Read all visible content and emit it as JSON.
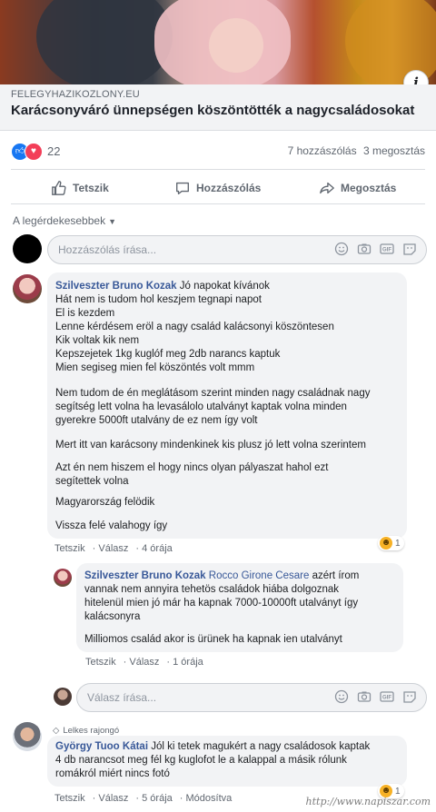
{
  "post": {
    "link_domain": "FELEGYHAZIKOZLONY.EU",
    "link_title": "Karácsonyváró ünnepségen köszöntötték a nagycsaládosokat",
    "reaction_count": "22",
    "comments_count": "7 hozzászólás",
    "shares_count": "3 megosztás"
  },
  "actions": {
    "like": "Tetszik",
    "comment": "Hozzászólás",
    "share": "Megosztás"
  },
  "sort_label": "A legérdekesebbek",
  "composer": {
    "placeholder": "Hozzászólás írása...",
    "reply_placeholder": "Válasz írása..."
  },
  "comments": [
    {
      "author": "Szilveszter Bruno Kozak",
      "first_line": "Jó napokat kívánok",
      "lines": [
        "Hát nem is tudom hol keszjem tegnapi napot",
        "El is kezdem",
        "Lenne kérdésem eröl a nagy család kalácsonyi köszöntesen",
        "Kik voltak kik nem",
        "Kepszejetek 1kg kuglóf meg 2db narancs kaptuk",
        "Mien segiseg mien fel köszöntés volt mmm"
      ],
      "para2": [
        "Nem tudom de én meglátásom szerint minden nagy családnak nagy",
        "segítség lett volna ha levasálolo utalványt kaptak volna minden",
        "gyerekre 5000ft utalvány de ez nem így volt"
      ],
      "para3": "Mert itt van karácsony mindenkinek kis plusz jó lett volna szerintem",
      "para4": [
        "Azt én nem hiszem el hogy nincs olyan pályaszat hahol ezt",
        "segítettek volna"
      ],
      "para5": "Magyarország felödik",
      "para6": "Vissza felé valahogy így",
      "meta": {
        "like": "Tetszik",
        "reply": "Válasz",
        "time": "4 órája"
      },
      "reaction_count": "1"
    },
    {
      "author": "Szilveszter Bruno Kozak",
      "tag": "Rocco Girone Cesare",
      "first_line": "azért írom",
      "lines": [
        "vannak nem annyira tehetös családok hiába dolgoznak",
        "hitelenül mien jó már ha kapnak 7000-10000ft utalványt így",
        "kalácsonyra"
      ],
      "para2": "Milliomos család akor is ürünek ha kapnak ien utalványt",
      "meta": {
        "like": "Tetszik",
        "reply": "Válasz",
        "time": "1 órája"
      }
    },
    {
      "badge": "Lelkes rajongó",
      "author": "György Tuoo Kátai",
      "first_line": "Jól ki tetek magukért a nagy családosok kaptak",
      "lines": [
        "4 db narancsot meg fél kg kuglofot le a kalappal a másik rólunk",
        "romákról miért nincs fotó"
      ],
      "meta": {
        "like": "Tetszik",
        "reply": "Válasz",
        "time": "5 órája",
        "edited": "Módosítva"
      },
      "reaction_count": "1"
    }
  ],
  "watermark": "http://www.napiszar.com",
  "colors": {
    "link": "#385898",
    "like_blue": "#1877f2",
    "love_red": "#f33e58"
  }
}
